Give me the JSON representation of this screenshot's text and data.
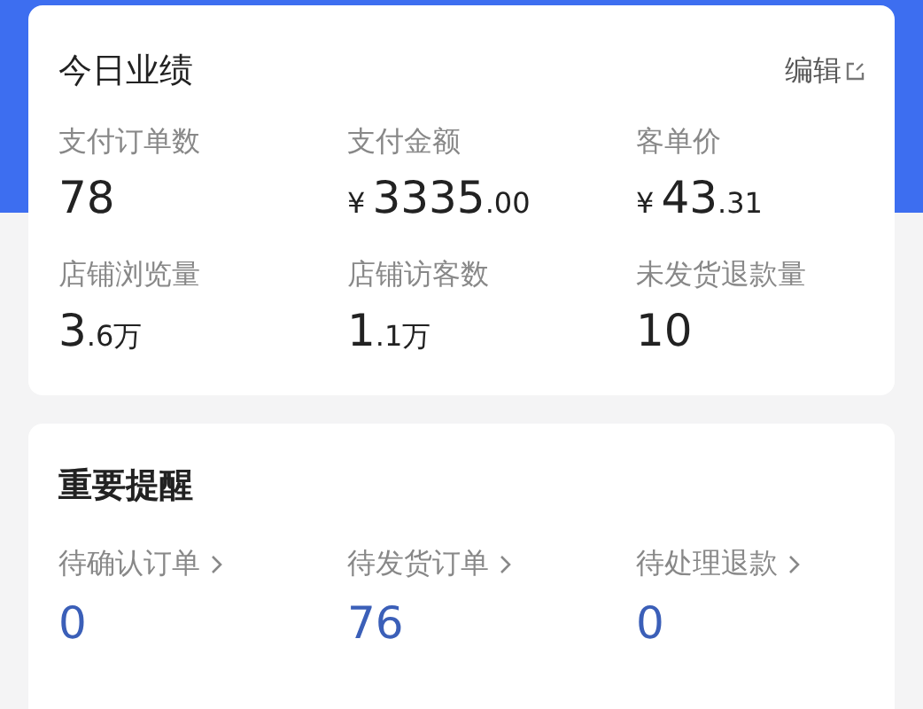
{
  "performance": {
    "title": "今日业绩",
    "edit_link": "编辑",
    "stats": [
      {
        "label": "支付订单数",
        "value": "78"
      },
      {
        "label": "支付金额",
        "prefix": "¥",
        "value": "3335",
        "small": ".00"
      },
      {
        "label": "客单价",
        "prefix": "¥",
        "value": "43",
        "small": ".31"
      },
      {
        "label": "店铺浏览量",
        "value": "3",
        "small": ".6万"
      },
      {
        "label": "店铺访客数",
        "value": "1",
        "small": ".1万"
      },
      {
        "label": "未发货退款量",
        "value": "10"
      }
    ]
  },
  "reminders": {
    "title": "重要提醒",
    "items": [
      {
        "label": "待确认订单",
        "count": "0"
      },
      {
        "label": "待发货订单",
        "count": "76"
      },
      {
        "label": "待处理退款",
        "count": "0"
      }
    ]
  }
}
